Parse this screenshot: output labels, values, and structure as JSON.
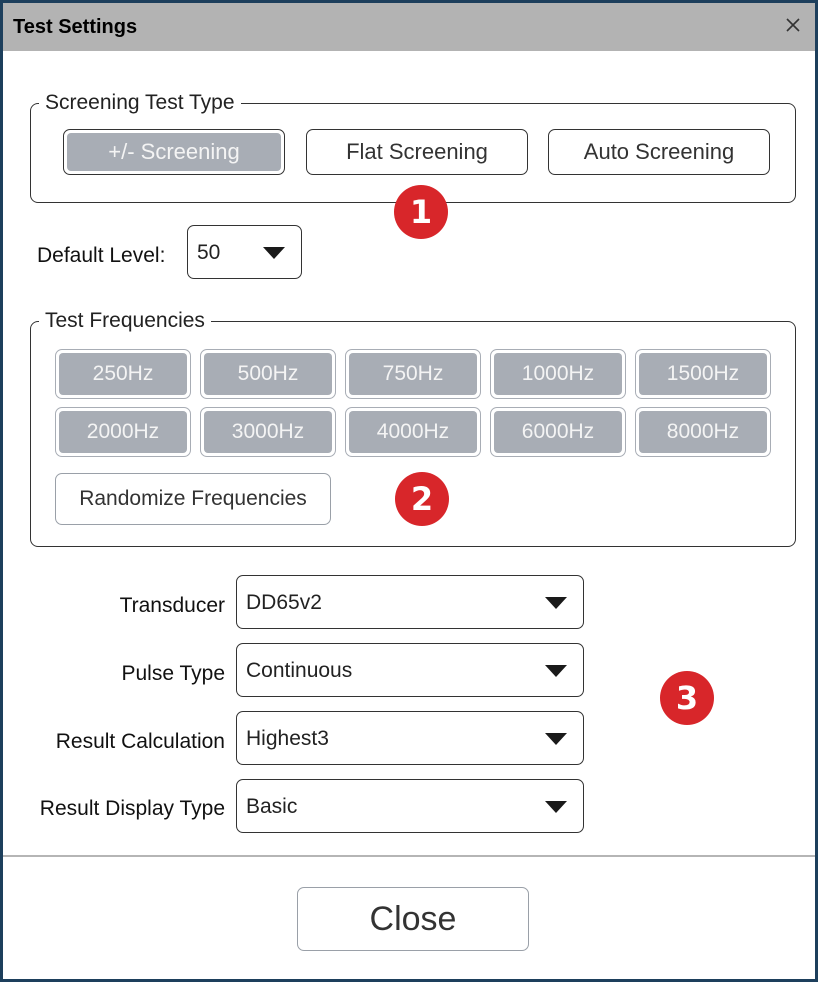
{
  "window": {
    "title": "Test Settings",
    "close_glyph": "×"
  },
  "screening": {
    "legend": "Screening Test Type",
    "options": [
      "+/- Screening",
      "Flat Screening",
      "Auto Screening"
    ],
    "selected": "+/- Screening"
  },
  "default_level": {
    "label": "Default Level:",
    "value": "50"
  },
  "frequencies": {
    "legend": "Test Frequencies",
    "row1": [
      "250Hz",
      "500Hz",
      "750Hz",
      "1000Hz",
      "1500Hz"
    ],
    "row2": [
      "2000Hz",
      "3000Hz",
      "4000Hz",
      "6000Hz",
      "8000Hz"
    ],
    "randomize_label": "Randomize Frequencies"
  },
  "settings": {
    "transducer": {
      "label": "Transducer",
      "value": "DD65v2"
    },
    "pulse_type": {
      "label": "Pulse Type",
      "value": "Continuous"
    },
    "result_calculation": {
      "label": "Result Calculation",
      "value": "Highest3"
    },
    "result_display_type": {
      "label": "Result Display Type",
      "value": "Basic"
    }
  },
  "markers": [
    "1",
    "2",
    "3"
  ],
  "footer": {
    "close_label": "Close"
  },
  "colors": {
    "selected_fill": "#a8adb5",
    "marker": "#d8262a",
    "titlebar": "#b3b3b3",
    "window_border": "#1d3f5c"
  },
  "icons": {
    "close": "close-icon",
    "dropdown": "chevron-down-icon"
  }
}
